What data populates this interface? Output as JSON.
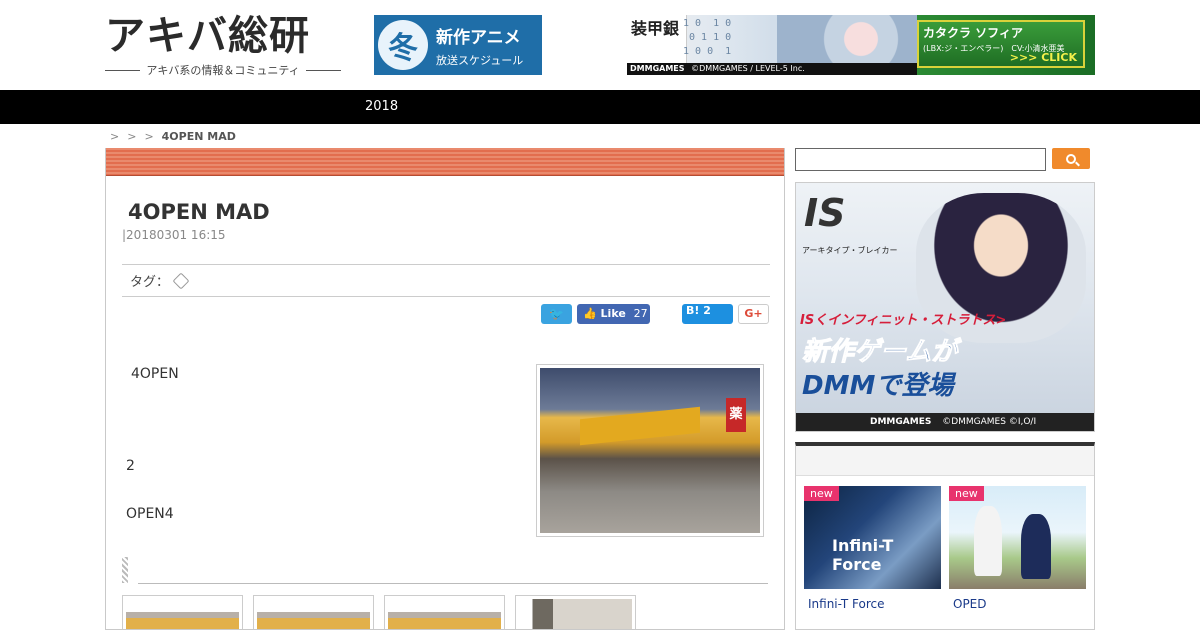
{
  "header": {
    "logo_main": "アキバ総研",
    "logo_sub": "アキバ系の情報＆コミュニティ",
    "banner_anime": {
      "kanji": "冬",
      "line1": "新作アニメ",
      "line2": "放送スケジュール"
    },
    "banner_game": {
      "left_text": "装甲銀",
      "title": "カタクラ ソフィア",
      "subtitle": "(LBX:ジ・エンペラー)　CV:小清水亜美",
      "cta": ">>> CLICK",
      "brand": "DMMGAMES",
      "copyright": "©DMMGAMES / LEVEL-5 Inc."
    }
  },
  "nav": {
    "item": "2018"
  },
  "breadcrumb": {
    "sep": ">",
    "current": "4OPEN MAD"
  },
  "article": {
    "title": "4OPEN MAD",
    "date": "|20180301 16:15",
    "tag_label": "タグ：",
    "share": {
      "fb_like": "Like",
      "fb_count": "27",
      "hatena_label": "B!",
      "hatena_count": "2",
      "gplus": "G+"
    },
    "para1": "4OPEN",
    "para2": "2",
    "para3": "OPEN4"
  },
  "sidebar": {
    "search_placeholder": "",
    "ad": {
      "logo": "IS",
      "subtitle": "アーキタイプ・ブレイカー",
      "red_text": "ISくインフィニット・ストラトス>",
      "big1": "新作ゲームが",
      "big2": "DMMで登場",
      "brand": "DMMGAMES",
      "copyright": "©DMMGAMES ©I,O/I"
    },
    "widget": {
      "title": "",
      "cards": [
        {
          "badge": "new",
          "overlay": "Infini-T Force",
          "caption": "Infini-T Force"
        },
        {
          "badge": "new",
          "caption": "OPED"
        }
      ]
    }
  }
}
